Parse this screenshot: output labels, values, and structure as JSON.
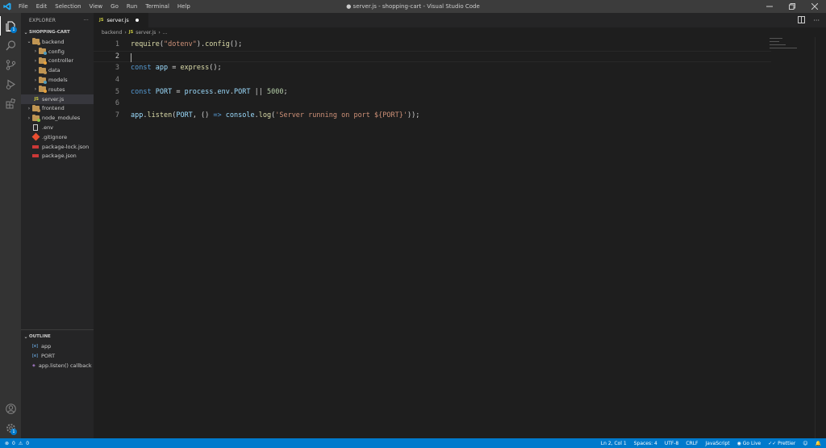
{
  "window": {
    "title": "● server.js - shopping-cart - Visual Studio Code",
    "menu": [
      "File",
      "Edit",
      "Selection",
      "View",
      "Go",
      "Run",
      "Terminal",
      "Help"
    ]
  },
  "activity_bar": {
    "explorer_badge": "1",
    "settings_badge": "1"
  },
  "sidebar": {
    "header": "EXPLORER",
    "more": "···",
    "workspace": "SHOPPING-CART",
    "tree": [
      {
        "label": "backend",
        "level": 1,
        "expanded": true,
        "type": "folder"
      },
      {
        "label": "config",
        "level": 2,
        "expanded": false,
        "type": "folder"
      },
      {
        "label": "controller",
        "level": 2,
        "expanded": false,
        "type": "folder"
      },
      {
        "label": "data",
        "level": 2,
        "expanded": false,
        "type": "folder"
      },
      {
        "label": "models",
        "level": 2,
        "expanded": false,
        "type": "folder"
      },
      {
        "label": "routes",
        "level": 2,
        "expanded": false,
        "type": "folder"
      },
      {
        "label": "server.js",
        "level": 2,
        "type": "js",
        "selected": true
      },
      {
        "label": "frontend",
        "level": 1,
        "expanded": false,
        "type": "folder"
      },
      {
        "label": "node_modules",
        "level": 1,
        "expanded": false,
        "type": "folder"
      },
      {
        "label": ".env",
        "level": 1,
        "type": "file"
      },
      {
        "label": ".gitignore",
        "level": 1,
        "type": "git"
      },
      {
        "label": "package-lock.json",
        "level": 1,
        "type": "json"
      },
      {
        "label": "package.json",
        "level": 1,
        "type": "json"
      }
    ],
    "outline_header": "OUTLINE",
    "outline": [
      {
        "label": "app",
        "symbol": "[e]"
      },
      {
        "label": "PORT",
        "symbol": "[e]"
      },
      {
        "label": "app.listen() callback",
        "symbol": "◈"
      }
    ]
  },
  "editor": {
    "tab": {
      "icon": "JS",
      "label": "server.js"
    },
    "breadcrumb": {
      "folder": "backend",
      "icon": "JS",
      "file": "server.js",
      "rest": "..."
    },
    "current_line": 2,
    "lines": [
      {
        "n": "1",
        "tokens": [
          [
            "fn",
            "require"
          ],
          [
            "",
            "("
          ],
          [
            "str",
            "\"dotenv\""
          ],
          [
            "",
            ")."
          ],
          [
            "fn",
            "config"
          ],
          [
            "",
            "();"
          ]
        ]
      },
      {
        "n": "2",
        "tokens": []
      },
      {
        "n": "3",
        "tokens": [
          [
            "kw",
            "const"
          ],
          [
            "",
            " "
          ],
          [
            "var",
            "app"
          ],
          [
            "",
            " = "
          ],
          [
            "fn",
            "express"
          ],
          [
            "",
            "();"
          ]
        ]
      },
      {
        "n": "4",
        "tokens": []
      },
      {
        "n": "5",
        "tokens": [
          [
            "kw",
            "const"
          ],
          [
            "",
            " "
          ],
          [
            "var",
            "PORT"
          ],
          [
            "",
            " = "
          ],
          [
            "var",
            "process"
          ],
          [
            "",
            "."
          ],
          [
            "var",
            "env"
          ],
          [
            "",
            "."
          ],
          [
            "var",
            "PORT"
          ],
          [
            "",
            " || "
          ],
          [
            "num",
            "5000"
          ],
          [
            "",
            ";"
          ]
        ]
      },
      {
        "n": "6",
        "tokens": []
      },
      {
        "n": "7",
        "tokens": [
          [
            "var",
            "app"
          ],
          [
            "",
            "."
          ],
          [
            "fn",
            "listen"
          ],
          [
            "",
            "("
          ],
          [
            "var",
            "PORT"
          ],
          [
            "",
            ", () "
          ],
          [
            "kw",
            "=>"
          ],
          [
            "",
            " "
          ],
          [
            "var",
            "console"
          ],
          [
            "",
            "."
          ],
          [
            "fn",
            "log"
          ],
          [
            "",
            "("
          ],
          [
            "str",
            "'Server running on port ${PORT}'"
          ],
          [
            "",
            "));"
          ]
        ]
      }
    ]
  },
  "status": {
    "errors": "0",
    "warnings": "0",
    "right": [
      "Ln 2, Col 1",
      "Spaces: 4",
      "UTF-8",
      "CRLF",
      "JavaScript",
      "Go Live",
      "Prettier"
    ]
  }
}
